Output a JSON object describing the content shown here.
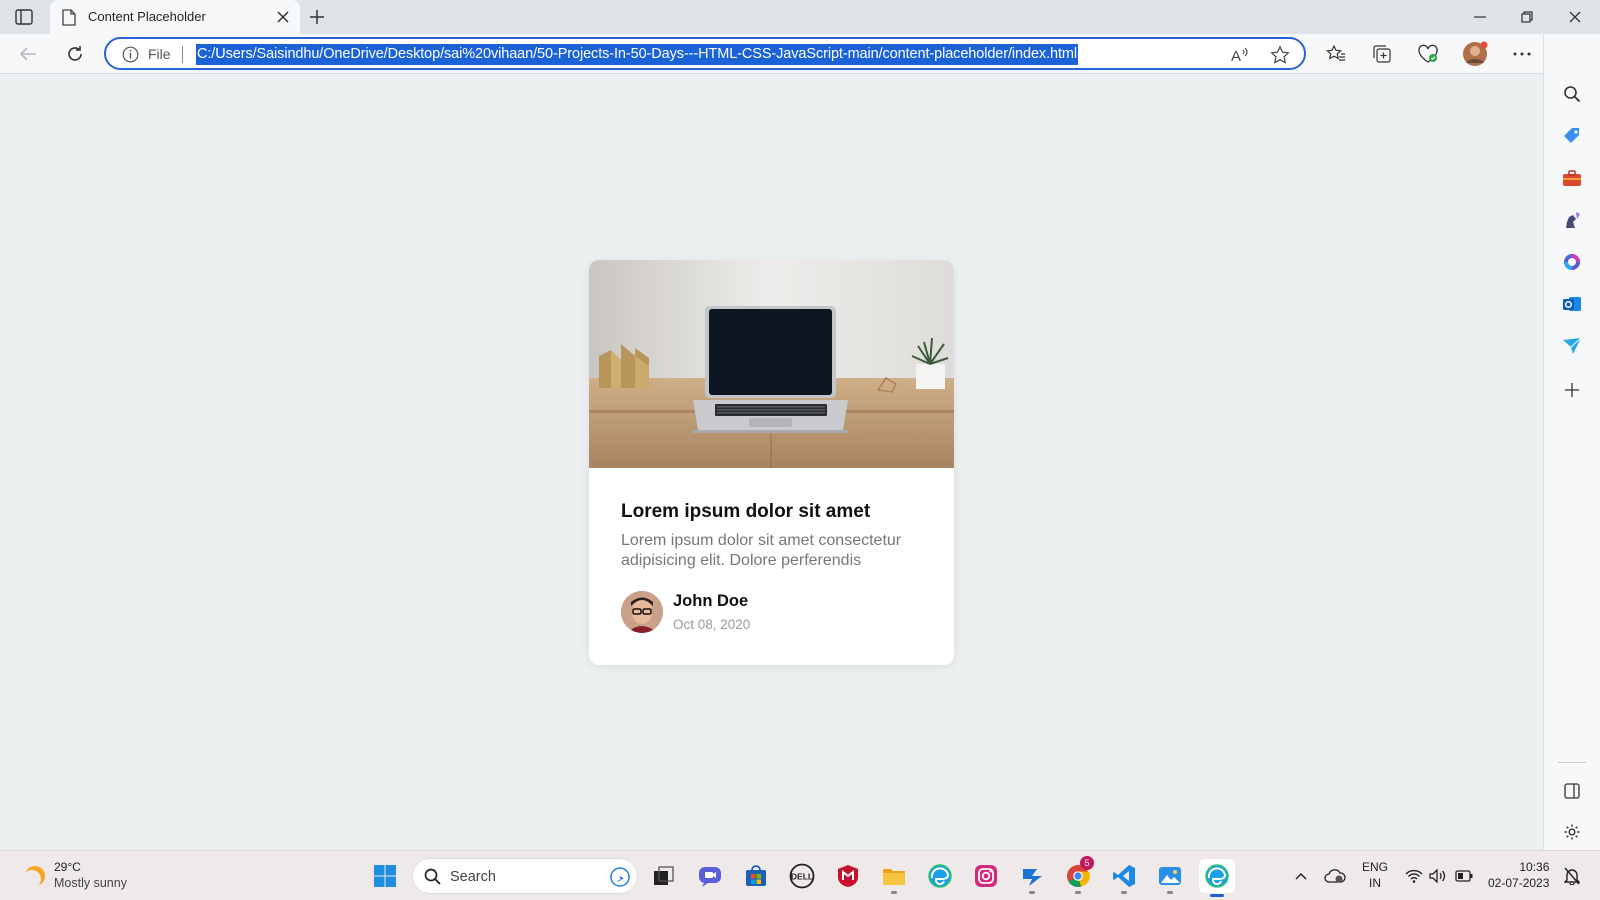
{
  "browser": {
    "tab_title": "Content Placeholder",
    "address_prefix": "File",
    "url": "C:/Users/Saisindhu/OneDrive/Desktop/sai%20vihaan/50-Projects-In-50-Days---HTML-CSS-JavaScript-main/content-placeholder/index.html",
    "accent": "#1a62d6"
  },
  "card": {
    "title": "Lorem ipsum dolor sit amet",
    "excerpt": "Lorem ipsum dolor sit amet consectetur adipisicing elit. Dolore perferendis",
    "author": "John Doe",
    "date": "Oct 08, 2020"
  },
  "taskbar": {
    "weather_temp": "29°C",
    "weather_desc": "Mostly sunny",
    "search_label": "Search",
    "lang_line1": "ENG",
    "lang_line2": "IN",
    "time": "10:36",
    "date": "02-07-2023",
    "chrome_badge": "5"
  }
}
